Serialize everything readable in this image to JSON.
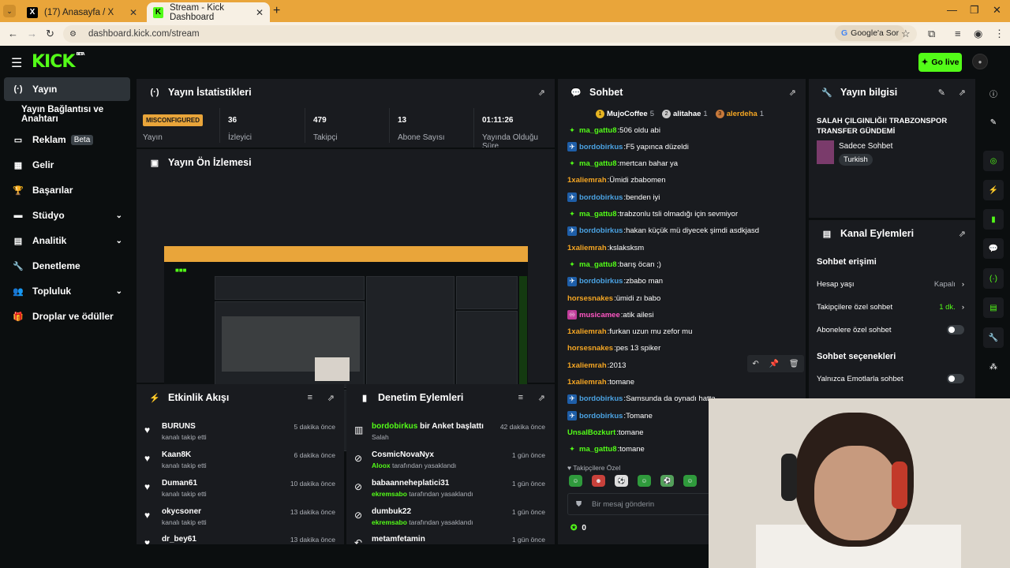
{
  "browser": {
    "tabs": [
      {
        "title": "(17) Anasayfa / X",
        "icon": "x-logo"
      },
      {
        "title": "Stream - Kick Dashboard",
        "icon": "kick-logo"
      }
    ],
    "url": "dashboard.kick.com/stream",
    "google_button": "Google'a Sor"
  },
  "header": {
    "logo": "KICK",
    "logo_sup": "BETA",
    "go_live": "Go live"
  },
  "sidebar": {
    "items": [
      {
        "label": "Yayın",
        "icon": "broadcast-icon"
      },
      {
        "label": "Yayın Bağlantısı ve Anahtarı",
        "icon": ""
      },
      {
        "label": "Reklam",
        "icon": "ad-icon",
        "badge": "Beta"
      },
      {
        "label": "Gelir",
        "icon": "chart-icon"
      },
      {
        "label": "Başarılar",
        "icon": "trophy-icon"
      },
      {
        "label": "Stüdyo",
        "icon": "studio-icon"
      },
      {
        "label": "Analitik",
        "icon": "analytics-icon"
      },
      {
        "label": "Denetleme",
        "icon": "wrench-icon"
      },
      {
        "label": "Topluluk",
        "icon": "people-icon"
      },
      {
        "label": "Droplar ve ödüller",
        "icon": "gift-icon"
      }
    ]
  },
  "stats": {
    "title": "Yayın İstatistikleri",
    "status": "MISCONFIGURED",
    "status_label": "Yayın",
    "items": [
      {
        "value": "36",
        "label": "İzleyici"
      },
      {
        "value": "479",
        "label": "Takipçi"
      },
      {
        "value": "13",
        "label": "Abone Sayısı"
      },
      {
        "value": "01:11:26",
        "label": "Yayında Olduğu Süre"
      }
    ]
  },
  "preview": {
    "title": "Yayın Ön İzlemesi"
  },
  "activity": {
    "title": "Etkinlik Akışı",
    "rows": [
      {
        "name": "BURUNS",
        "sub": "kanalı takip etti",
        "time": "5 dakika önce"
      },
      {
        "name": "Kaan8K",
        "sub": "kanalı takip etti",
        "time": "6 dakika önce"
      },
      {
        "name": "Duman61",
        "sub": "kanalı takip etti",
        "time": "10 dakika önce"
      },
      {
        "name": "okycsoner",
        "sub": "kanalı takip etti",
        "time": "13 dakika önce"
      },
      {
        "name": "dr_bey61",
        "sub": "",
        "time": "13 dakika önce"
      }
    ]
  },
  "moderation": {
    "title": "Denetim Eylemleri",
    "rows": [
      {
        "name": "bordobirkus",
        "action": "bir Anket başlattı",
        "sub_name": "",
        "sub": "Salah",
        "time": "42 dakika önce",
        "icon": "poll-icon"
      },
      {
        "name": "CosmicNovaNyx",
        "action": "",
        "sub_name": "Aloox",
        "sub": "tarafından yasaklandı",
        "time": "1 gün önce",
        "icon": "ban-icon"
      },
      {
        "name": "babaanneheplatici31",
        "action": "",
        "sub_name": "ekremsabo",
        "sub": "tarafından yasaklandı",
        "time": "1 gün önce",
        "icon": "ban-icon"
      },
      {
        "name": "dumbuk22",
        "action": "",
        "sub_name": "ekremsabo",
        "sub": "tarafından yasaklandı",
        "time": "1 gün önce",
        "icon": "ban-icon"
      },
      {
        "name": "metamfetamin",
        "action": "",
        "sub_name": "",
        "sub": "",
        "time": "1 gün önce",
        "icon": "undo-icon"
      }
    ]
  },
  "chat": {
    "title": "Sohbet",
    "top_gifters": [
      {
        "name": "MujoCoffee",
        "count": "5",
        "rank": "1",
        "color": "#e6b422"
      },
      {
        "name": "alitahae",
        "count": "1",
        "rank": "2",
        "color": "#c8c8c8"
      },
      {
        "name": "alerdeha",
        "count": "1",
        "rank": "3",
        "color": "#c7793b"
      }
    ],
    "messages": [
      {
        "user": "ma_gattu8",
        "text": "506 oldu abi",
        "color": "green",
        "badge": "green"
      },
      {
        "user": "bordobirkus",
        "text": "F5 yapınca düzeldi",
        "color": "blue",
        "badge": "blue"
      },
      {
        "user": "ma_gattu8",
        "text": "mertcan bahar ya",
        "color": "green",
        "badge": "green"
      },
      {
        "user": "1xaliemrah",
        "text": "Ümidi zbabomen",
        "color": "orange",
        "badge": ""
      },
      {
        "user": "bordobirkus",
        "text": "benden iyi",
        "color": "blue",
        "badge": "blue"
      },
      {
        "user": "ma_gattu8",
        "text": "trabzonlu tsli olmadığı için sevmiyor",
        "color": "green",
        "badge": "green"
      },
      {
        "user": "bordobirkus",
        "text": "hakan küçük mü diyecek şimdi asdkjasd",
        "color": "blue",
        "badge": "blue"
      },
      {
        "user": "1xaliemrah",
        "text": "kslaksksm",
        "color": "orange",
        "badge": ""
      },
      {
        "user": "ma_gattu8",
        "text": "barış öcan ;)",
        "color": "green",
        "badge": "green"
      },
      {
        "user": "bordobirkus",
        "text": "zbabo man",
        "color": "blue",
        "badge": "blue"
      },
      {
        "user": "horsesnakes",
        "text": "ümidi zı babo",
        "color": "orange",
        "badge": ""
      },
      {
        "user": "musicamee",
        "text": "atik ailesi",
        "color": "pink",
        "badge": "pink"
      },
      {
        "user": "1xaliemrah",
        "text": "furkan uzun mu zefor mu",
        "color": "orange",
        "badge": ""
      },
      {
        "user": "horsesnakes",
        "text": "pes 13 spiker",
        "color": "orange",
        "badge": ""
      },
      {
        "user": "1xaliemrah",
        "text": "2013",
        "color": "orange",
        "badge": ""
      },
      {
        "user": "1xaliemrah",
        "text": "tomane",
        "color": "orange",
        "badge": ""
      },
      {
        "user": "bordobirkus",
        "text": "Samsunda da oynadı hatta",
        "color": "blue",
        "badge": "blue"
      },
      {
        "user": "bordobirkus",
        "text": "Tomane",
        "color": "blue",
        "badge": "blue"
      },
      {
        "user": "UnsalBozkurt",
        "text": "tomane",
        "color": "green",
        "badge": ""
      },
      {
        "user": "ma_gattu8",
        "text": "tomane",
        "color": "green",
        "badge": "green"
      }
    ],
    "followers_only": "Takipçilere Özel",
    "input_placeholder": "Bir mesaj gönderin",
    "points": "0"
  },
  "stream_info": {
    "title": "Yayın bilgisi",
    "stream_title": "SALAH ÇILGINLIĞI! TRABZONSPOR TRANSFER GÜNDEMİ",
    "category": "Sadece Sohbet",
    "language": "Turkish"
  },
  "channel_actions": {
    "title": "Kanal Eylemleri",
    "chat_access": "Sohbet erişimi",
    "account_age": {
      "label": "Hesap yaşı",
      "value": "Kapalı"
    },
    "followers_chat": {
      "label": "Takipçilere özel sohbet",
      "value": "1 dk."
    },
    "subscribers_chat": {
      "label": "Abonelere özel sohbet"
    },
    "chat_options": "Sohbet seçenekleri",
    "emote_only": {
      "label": "Yalnızca Emotlarla sohbet"
    }
  },
  "colors": {
    "accent": "#53fc18",
    "panel": "#191b1f",
    "background": "#0b0e0f"
  }
}
